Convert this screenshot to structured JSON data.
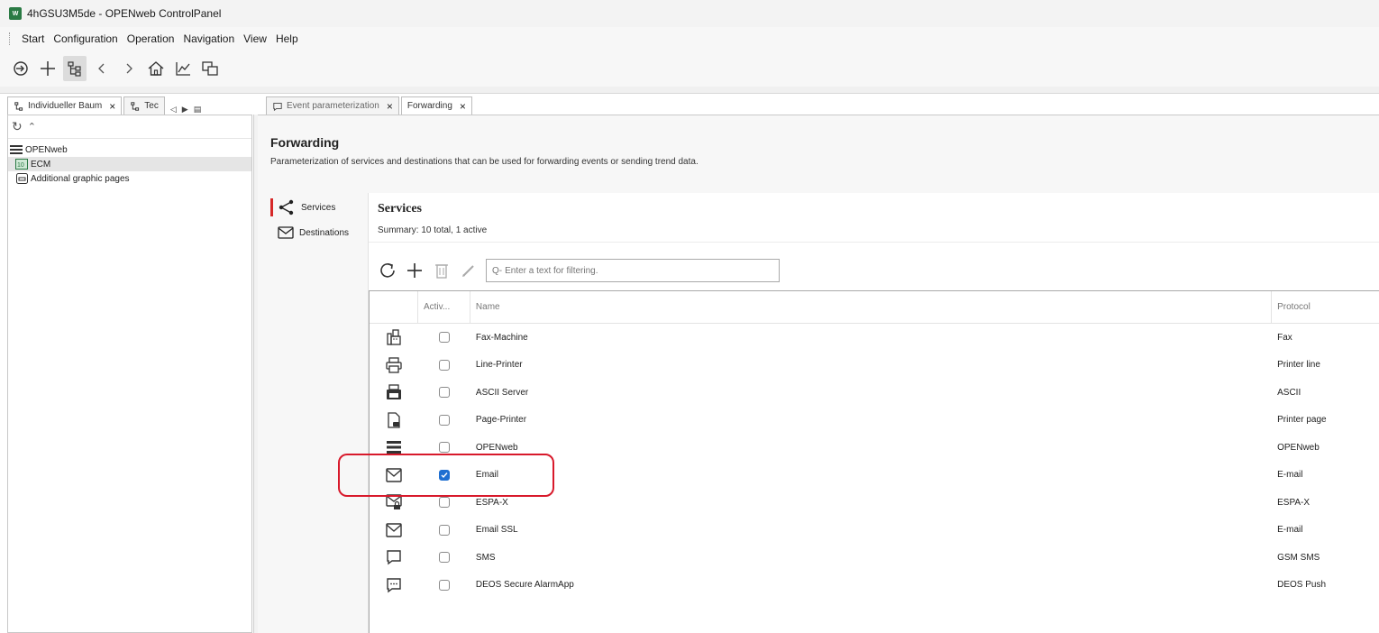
{
  "window": {
    "title": "4hGSU3M5de - OPENweb ControlPanel",
    "app_icon_text": "W"
  },
  "menu": [
    "Start",
    "Configuration",
    "Operation",
    "Navigation",
    "View",
    "Help"
  ],
  "toolbar": {
    "icons": [
      "logout-icon",
      "plus-icon",
      "tree-icon",
      "back-chevron-icon",
      "forward-chevron-icon",
      "home-icon",
      "trend-icon",
      "windows-icon"
    ]
  },
  "left_tabs": [
    {
      "label": "Individueller Baum",
      "close": "×"
    },
    {
      "label": "Tec",
      "close": ""
    }
  ],
  "right_tabs": [
    {
      "label": "Event parameterization",
      "close": "×"
    },
    {
      "label": "Forwarding",
      "close": "×"
    }
  ],
  "tree": [
    {
      "label": "OPENweb",
      "level": 0
    },
    {
      "label": "ECM",
      "level": 1,
      "selected": true
    },
    {
      "label": "Additional graphic pages",
      "level": 1
    }
  ],
  "forwarding": {
    "title": "Forwarding",
    "description": "Parameterization of services and destinations that can be used for forwarding events or sending trend data."
  },
  "nav": [
    {
      "label": "Services",
      "active": true
    },
    {
      "label": "Destinations",
      "active": false
    }
  ],
  "services": {
    "title": "Services",
    "summary": "Summary: 10 total, 1 active",
    "filter_placeholder": "Enter a text for filtering.",
    "filter_prefix": "Q-",
    "columns": {
      "active": "Activ...",
      "name": "Name",
      "protocol": "Protocol"
    },
    "rows": [
      {
        "icon": "fax-icon",
        "active": false,
        "name": "Fax-Machine",
        "protocol": "Fax"
      },
      {
        "icon": "printer-icon",
        "active": false,
        "name": "Line-Printer",
        "protocol": "Printer line"
      },
      {
        "icon": "ascii-printer-icon",
        "active": false,
        "name": "ASCII Server",
        "protocol": "ASCII"
      },
      {
        "icon": "page-printer-icon",
        "active": false,
        "name": "Page-Printer",
        "protocol": "Printer page"
      },
      {
        "icon": "openweb-icon",
        "active": false,
        "name": "OPENweb",
        "protocol": "OPENweb"
      },
      {
        "icon": "mail-icon",
        "active": true,
        "name": "Email",
        "protocol": "E-mail"
      },
      {
        "icon": "mail-lock-icon",
        "active": false,
        "name": "ESPA-X",
        "protocol": "ESPA-X"
      },
      {
        "icon": "mail-icon",
        "active": false,
        "name": "Email SSL",
        "protocol": "E-mail"
      },
      {
        "icon": "sms-icon",
        "active": false,
        "name": "SMS",
        "protocol": "GSM SMS"
      },
      {
        "icon": "chat-icon",
        "active": false,
        "name": "DEOS Secure AlarmApp",
        "protocol": "DEOS Push"
      }
    ]
  },
  "highlight": {
    "label": "",
    "color": "#d8192b"
  },
  "colors": {
    "accent": "#1f6fd1",
    "nav_marker": "#d62828"
  }
}
